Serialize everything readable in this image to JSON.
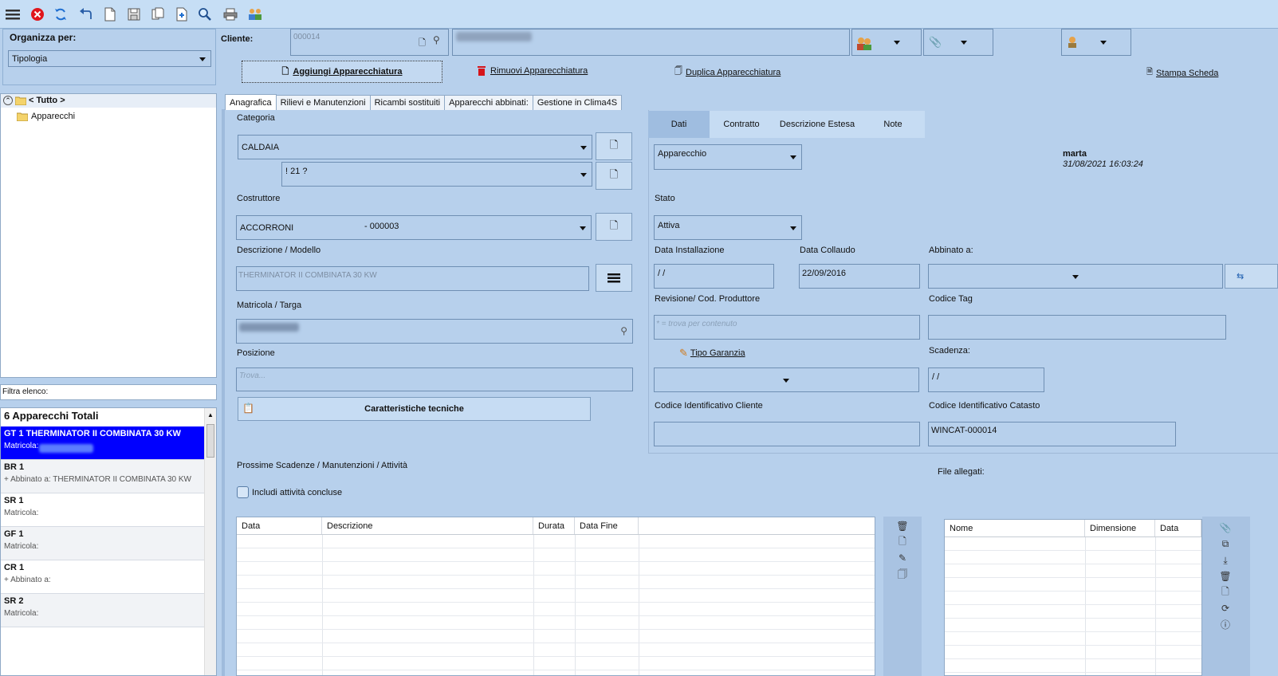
{
  "toolbar": {
    "icons": [
      "menu-icon",
      "close-icon",
      "refresh-icon",
      "undo-icon",
      "new-icon",
      "save-icon",
      "copy-icon",
      "add-icon",
      "search-icon",
      "print-icon",
      "users-icon"
    ]
  },
  "sidebar": {
    "organize_label": "Organizza per:",
    "organize_value": "Tipologia",
    "tree_root": "< Tutto >",
    "tree_child": "Apparecchi",
    "filter_label": "Filtra elenco:",
    "total_label": "6 Apparecchi Totali",
    "items": [
      {
        "title": "GT 1 THERMINATOR II COMBINATA 30 KW",
        "sub": "Matricola:"
      },
      {
        "title": "BR 1",
        "sub": "+ Abbinato a: THERMINATOR II COMBINATA 30 KW"
      },
      {
        "title": "SR 1",
        "sub": "Matricola:"
      },
      {
        "title": "GF 1",
        "sub": "Matricola:"
      },
      {
        "title": "CR 1",
        "sub": "+ Abbinato a:"
      },
      {
        "title": "SR 2",
        "sub": "Matricola:"
      }
    ]
  },
  "header": {
    "client_label": "Cliente:",
    "client_code": "000014",
    "add_label": "Aggiungi Apparecchiatura",
    "remove_label": "Rimuovi Apparecchiatura",
    "duplicate_label": "Duplica Apparecchiatura",
    "print_label": "Stampa Scheda"
  },
  "tabs": [
    "Anagrafica",
    "Rilievi e Manutenzioni",
    "Ricambi sostituiti",
    "Apparecchi abbinati:",
    "Gestione in Clima4S"
  ],
  "left_form": {
    "category_label": "Categoria",
    "category_value": "CALDAIA",
    "subcategory_value": "! 21 ?",
    "manufacturer_label": "Costruttore",
    "manufacturer_value": "ACCORRONI",
    "manufacturer_code": "- 000003",
    "model_label": "Descrizione / Modello",
    "model_value": "THERMINATOR II COMBINATA 30 KW",
    "serial_label": "Matricola / Targa",
    "position_label": "Posizione",
    "position_placeholder": "Trova...",
    "tech_button": "Caratteristiche tecniche"
  },
  "right_tabs": [
    "Dati",
    "Contratto",
    "Descrizione Estesa",
    "Note"
  ],
  "right_form": {
    "type_value": "Apparecchio",
    "user": "marta",
    "timestamp": "31/08/2021 16:03:24",
    "state_label": "Stato",
    "state_value": "Attiva",
    "install_label": "Data Installazione",
    "install_value": " /  /",
    "test_label": "Data Collaudo",
    "test_value": "22/09/2016",
    "linked_label": "Abbinato a:",
    "revision_label": "Revisione/ Cod. Produttore",
    "revision_placeholder": "* = trova per contenuto",
    "tag_label": "Codice Tag",
    "warranty_label": "Tipo Garanzia",
    "expiry_label": "Scadenza:",
    "expiry_value": " /  /",
    "client_id_label": "Codice Identificativo Cliente",
    "cadastre_label": "Codice Identificativo Catasto",
    "cadastre_value": "WINCAT-000014"
  },
  "activities": {
    "title": "Prossime Scadenze / Manutenzioni / Attività",
    "include_label": "Includi attività concluse",
    "columns": [
      "Data",
      "Descrizione",
      "Durata",
      "Data Fine"
    ]
  },
  "attachments": {
    "title": "File allegati:",
    "columns": [
      "Nome",
      "Dimensione",
      "Data"
    ]
  },
  "colors": {
    "selection": "#0000ff",
    "panel": "#b7d0ec",
    "toolbar": "#c6def5"
  }
}
